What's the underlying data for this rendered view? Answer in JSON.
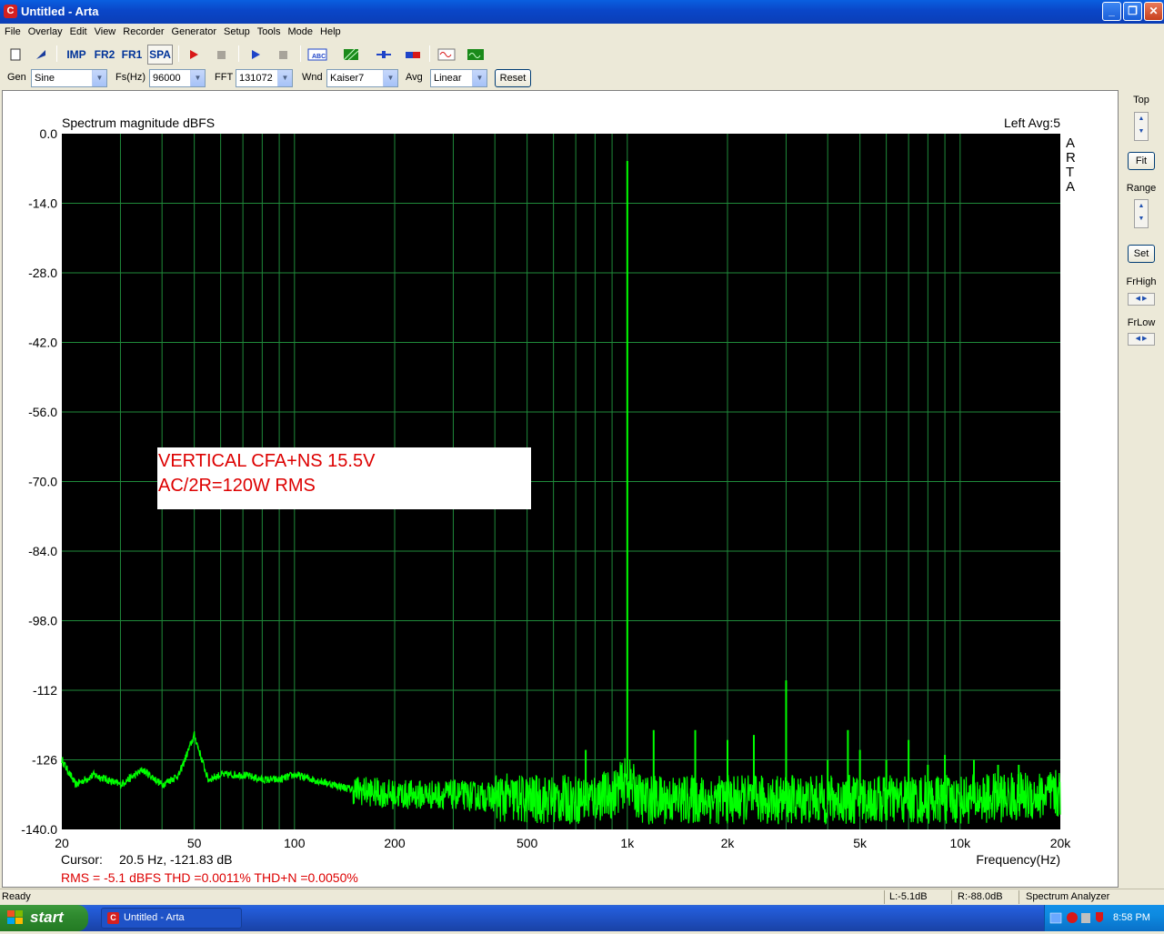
{
  "window": {
    "title": "Untitled - Arta",
    "app_icon": "arta-c-icon",
    "buttons": {
      "minimize": "_",
      "maximize": "❐",
      "close": "✕"
    }
  },
  "menu": [
    "File",
    "Overlay",
    "Edit",
    "View",
    "Recorder",
    "Generator",
    "Setup",
    "Tools",
    "Mode",
    "Help"
  ],
  "toolbar": {
    "imp": "IMP",
    "fr2": "FR2",
    "fr1": "FR1",
    "spa": "SPA"
  },
  "options": {
    "gen_label": "Gen",
    "gen_value": "Sine",
    "fs_label": "Fs(Hz)",
    "fs_value": "96000",
    "fft_label": "FFT",
    "fft_value": "131072",
    "wnd_label": "Wnd",
    "wnd_value": "Kaiser7",
    "avg_label": "Avg",
    "avg_value": "Linear",
    "reset_label": "Reset"
  },
  "right_panel": {
    "top": "Top",
    "fit": "Fit",
    "range": "Range",
    "set": "Set",
    "frhigh": "FrHigh",
    "frlow": "FrLow"
  },
  "plot": {
    "title": "Spectrum magnitude dBFS",
    "channel": "Left  Avg:5",
    "brand": [
      "A",
      "R",
      "T",
      "A"
    ],
    "annotation_line1": "VERTICAL CFA+NS 15.5V",
    "annotation_line2": "AC/2R=120W RMS",
    "cursor_label": "Cursor:",
    "cursor_value": "20.5 Hz, -121.83 dB",
    "stats": "RMS =   -5.1 dBFS   THD =0.0011%   THD+N =0.0050%",
    "xlabel": "Frequency(Hz)",
    "colors": {
      "background": "#000000",
      "grid": "#1f8a3a",
      "trace": "#00ff00",
      "annotation": "#dd0000"
    }
  },
  "chart_data": {
    "type": "line",
    "title": "Spectrum magnitude dBFS",
    "xlabel": "Frequency(Hz)",
    "ylabel": "",
    "xscale": "log",
    "xlim": [
      20,
      20000
    ],
    "ylim": [
      -140,
      0
    ],
    "x_ticks": [
      20,
      50,
      100,
      200,
      500,
      1000,
      2000,
      5000,
      10000,
      20000
    ],
    "x_tick_labels": [
      "20",
      "50",
      "100",
      "200",
      "500",
      "1k",
      "2k",
      "5k",
      "10k",
      "20k"
    ],
    "y_ticks": [
      0,
      -14,
      -28,
      -42,
      -56,
      -70,
      -84,
      -98,
      -112,
      -126,
      -140
    ],
    "y_tick_labels": [
      "0.0",
      "-14.0",
      "-28.0",
      "-42.0",
      "-56.0",
      "-70.0",
      "-84.0",
      "-98.0",
      "-112",
      "-126",
      "-140.0"
    ],
    "grid": true,
    "series": [
      {
        "noise_floor": [
          [
            20,
            -126
          ],
          [
            22,
            -131
          ],
          [
            25,
            -129
          ],
          [
            30,
            -131
          ],
          [
            35,
            -128
          ],
          [
            40,
            -131
          ],
          [
            45,
            -129
          ],
          [
            50,
            -121
          ],
          [
            55,
            -130
          ],
          [
            60,
            -129
          ],
          [
            70,
            -129
          ],
          [
            80,
            -130
          ],
          [
            90,
            -130
          ],
          [
            100,
            -129
          ],
          [
            150,
            -132
          ],
          [
            200,
            -133
          ],
          [
            300,
            -133
          ],
          [
            500,
            -134
          ],
          [
            700,
            -134
          ],
          [
            900,
            -133
          ],
          [
            1000,
            -130
          ],
          [
            1100,
            -134
          ],
          [
            2000,
            -134
          ],
          [
            5000,
            -134
          ],
          [
            10000,
            -134
          ],
          [
            20000,
            -133
          ]
        ],
        "peaks": [
          {
            "f": 1000,
            "db": -5.5
          },
          {
            "f": 2000,
            "db": -122
          },
          {
            "f": 3000,
            "db": -110
          },
          {
            "f": 4000,
            "db": -126
          },
          {
            "f": 5000,
            "db": -124
          },
          {
            "f": 6000,
            "db": -126
          },
          {
            "f": 7000,
            "db": -122
          },
          {
            "f": 8000,
            "db": -127
          },
          {
            "f": 9000,
            "db": -125
          },
          {
            "f": 11000,
            "db": -126
          },
          {
            "f": 13000,
            "db": -127
          },
          {
            "f": 15000,
            "db": -127
          },
          {
            "f": 1200,
            "db": -120
          },
          {
            "f": 1600,
            "db": -120
          },
          {
            "f": 2400,
            "db": -121
          },
          {
            "f": 4600,
            "db": -120
          },
          {
            "f": 750,
            "db": -124
          }
        ]
      }
    ]
  },
  "status": {
    "ready": "Ready",
    "level": "L:-5.1dB",
    "right": "R:-88.0dB",
    "mode": "Spectrum Analyzer"
  },
  "taskbar": {
    "start": "start",
    "item": "Untitled - Arta",
    "clock": "8:58 PM"
  }
}
